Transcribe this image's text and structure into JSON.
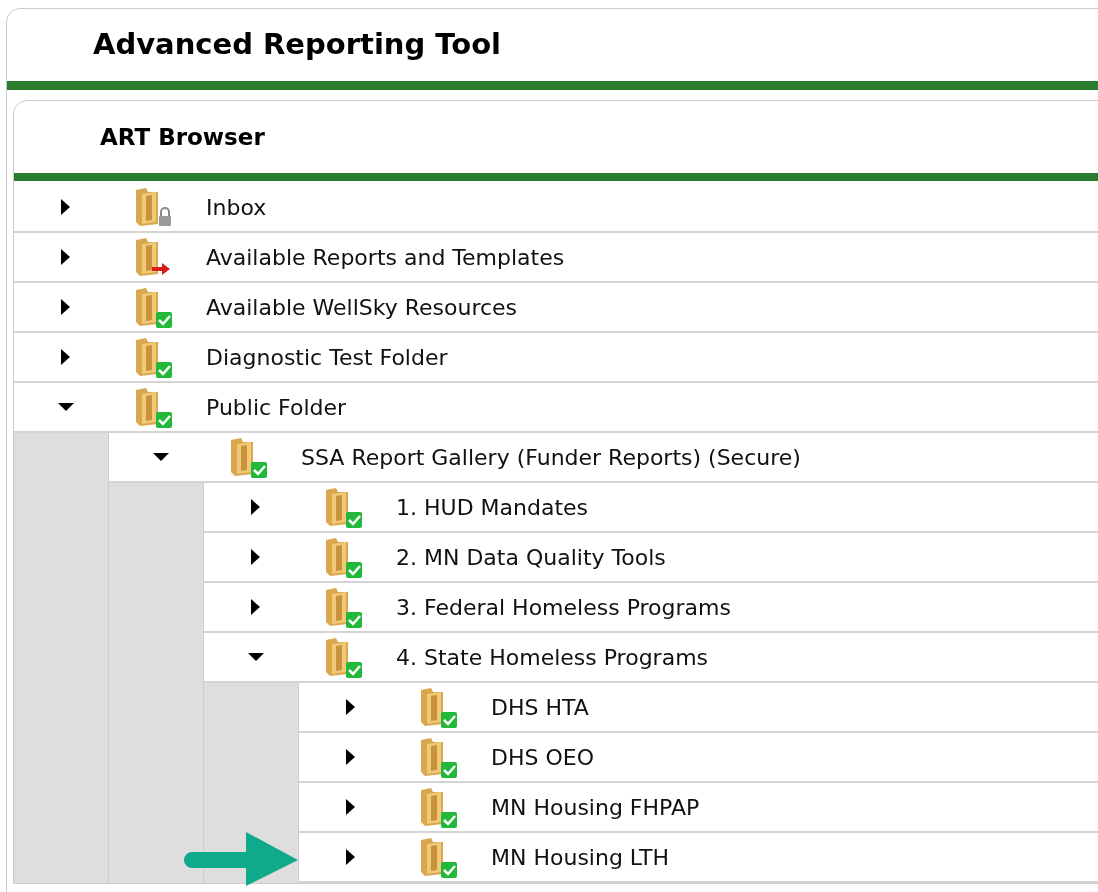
{
  "window": {
    "title": "Advanced Reporting Tool"
  },
  "panel": {
    "title": "ART Browser"
  },
  "tree": [
    {
      "label": "Inbox",
      "kind": "locked",
      "expanded": false
    },
    {
      "label": "Available Reports and Templates",
      "kind": "shared",
      "expanded": false
    },
    {
      "label": "Available WellSky Resources",
      "kind": "checked",
      "expanded": false
    },
    {
      "label": "Diagnostic Test Folder",
      "kind": "checked",
      "expanded": false
    },
    {
      "label": "Public Folder",
      "kind": "checked",
      "expanded": true,
      "children": [
        {
          "label": "SSA Report Gallery (Funder Reports) (Secure)",
          "kind": "checked",
          "expanded": true,
          "children": [
            {
              "label": "1. HUD Mandates",
              "kind": "checked",
              "expanded": false
            },
            {
              "label": "2. MN Data Quality Tools",
              "kind": "checked",
              "expanded": false
            },
            {
              "label": "3. Federal Homeless Programs",
              "kind": "checked",
              "expanded": false
            },
            {
              "label": "4. State Homeless Programs",
              "kind": "checked",
              "expanded": true,
              "children": [
                {
                  "label": "DHS HTA",
                  "kind": "checked",
                  "expanded": false
                },
                {
                  "label": "DHS OEO",
                  "kind": "checked",
                  "expanded": false
                },
                {
                  "label": "MN Housing FHPAP",
                  "kind": "checked",
                  "expanded": false
                },
                {
                  "label": "MN Housing LTH",
                  "kind": "checked",
                  "expanded": false
                }
              ]
            }
          ]
        }
      ]
    }
  ],
  "callout": {
    "kind": "arrow"
  }
}
